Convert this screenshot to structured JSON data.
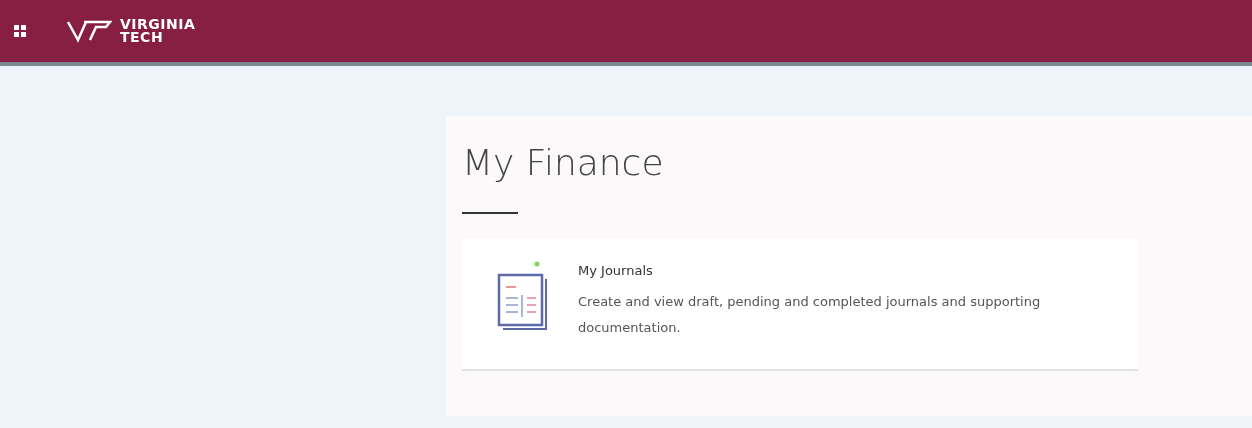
{
  "header": {
    "logo_lines": [
      "VIRGINIA",
      "TECH"
    ]
  },
  "page": {
    "title": "My Finance"
  },
  "cards": [
    {
      "title": "My Journals",
      "description": "Create and view draft, pending and completed journals and supporting documentation."
    }
  ]
}
